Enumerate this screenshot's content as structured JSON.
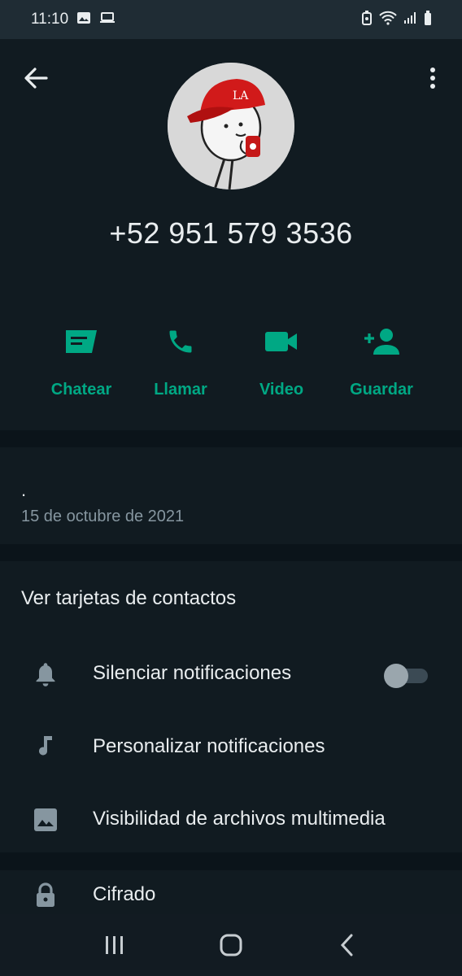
{
  "status": {
    "time": "11:10"
  },
  "contact": {
    "phone": "+52 951 579 3536",
    "about_text": ".",
    "about_date": "15 de octubre de 2021"
  },
  "actions": [
    {
      "label": "Chatear",
      "icon": "chat-icon"
    },
    {
      "label": "Llamar",
      "icon": "phone-icon"
    },
    {
      "label": "Video",
      "icon": "video-icon"
    },
    {
      "label": "Guardar",
      "icon": "add-contact-icon"
    }
  ],
  "settings": {
    "title": "Ver tarjetas de contactos",
    "mute_label": "Silenciar notificaciones",
    "mute_enabled": false,
    "custom_notif_label": "Personalizar notificaciones",
    "media_visibility_label": "Visibilidad de archivos multimedia"
  },
  "security": {
    "label": "Cifrado"
  },
  "colors": {
    "accent": "#00a884",
    "background": "#0b141a",
    "panel": "#111b21"
  }
}
